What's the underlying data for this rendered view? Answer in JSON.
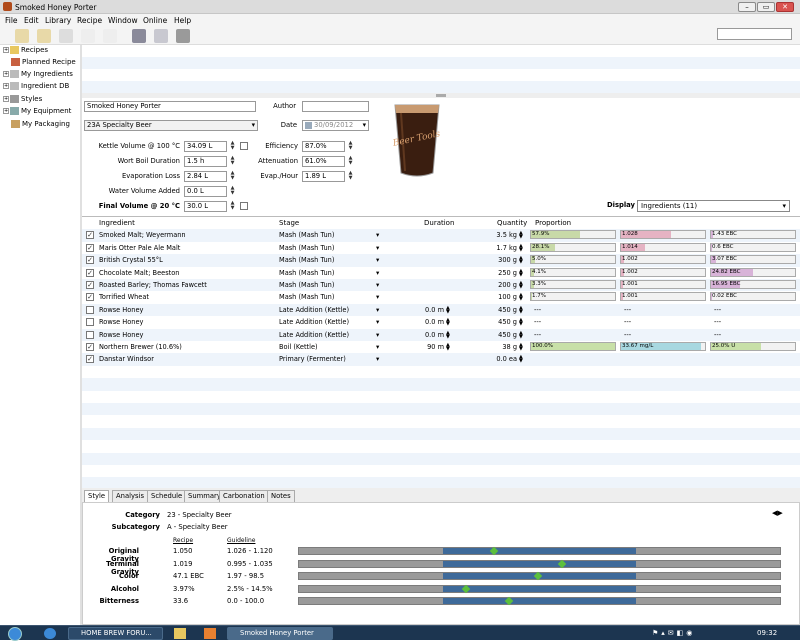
{
  "window": {
    "title": "Smoked Honey Porter"
  },
  "menu": [
    "File",
    "Edit",
    "Library",
    "Recipe",
    "Window",
    "Online",
    "Help"
  ],
  "tree": [
    {
      "label": "Recipes",
      "expander": "+"
    },
    {
      "label": "Planned Recipe",
      "expander": ""
    },
    {
      "label": "My Ingredients",
      "expander": "+"
    },
    {
      "label": "Ingredient DB",
      "expander": "+"
    },
    {
      "label": "Styles",
      "expander": "+"
    },
    {
      "label": "My Equipment",
      "expander": "+"
    },
    {
      "label": "My Packaging",
      "expander": ""
    }
  ],
  "recipe": {
    "name": "Smoked Honey Porter",
    "author_label": "Author",
    "author": "",
    "style": "23A Specialty Beer",
    "date_label": "Date",
    "date": "30/09/2012",
    "params": [
      {
        "label": "Kettle Volume @ 100 °C",
        "value": "34.09 L"
      },
      {
        "label": "Wort Boil Duration",
        "value": "1.5 h"
      },
      {
        "label": "Evaporation Loss",
        "value": "2.84 L"
      },
      {
        "label": "Water Volume Added",
        "value": "0.0 L"
      },
      {
        "label": "Final Volume @ 20 °C",
        "value": "30.0 L"
      }
    ],
    "params2": [
      {
        "label": "Efficiency",
        "value": "87.0%"
      },
      {
        "label": "Attenuation",
        "value": "61.0%"
      },
      {
        "label": "Evap./Hour",
        "value": "1.89 L"
      }
    ],
    "display_label": "Display",
    "display_value": "Ingredients (11)",
    "glass_logo": "Beer Tools"
  },
  "table": {
    "headers": {
      "ingredient": "Ingredient",
      "stage": "Stage",
      "duration": "Duration",
      "quantity": "Quantity",
      "proportion": "Proportion"
    },
    "rows": [
      {
        "checked": true,
        "name": "Smoked Malt; Weyermann",
        "stage": "Mash (Mash Tun)",
        "duration": "",
        "qty": "3.5 kg",
        "p1": "57.9%",
        "p1v": 0.579,
        "p2": "1.028",
        "p2v": 0.6,
        "p3": "1.43 EBC",
        "p3v": 0.02
      },
      {
        "checked": true,
        "name": "Maris Otter Pale Ale Malt",
        "stage": "Mash (Mash Tun)",
        "duration": "",
        "qty": "1.7 kg",
        "p1": "28.1%",
        "p1v": 0.281,
        "p2": "1.014",
        "p2v": 0.28,
        "p3": "0.6 EBC",
        "p3v": 0.01
      },
      {
        "checked": true,
        "name": "British Crystal 55°L",
        "stage": "Mash (Mash Tun)",
        "duration": "",
        "qty": "300 g",
        "p1": "5.0%",
        "p1v": 0.05,
        "p2": "1.002",
        "p2v": 0.04,
        "p3": "3.07 EBC",
        "p3v": 0.06
      },
      {
        "checked": true,
        "name": "Chocolate Malt; Beeston",
        "stage": "Mash (Mash Tun)",
        "duration": "",
        "qty": "250 g",
        "p1": "4.1%",
        "p1v": 0.041,
        "p2": "1.002",
        "p2v": 0.04,
        "p3": "24.82 EBC",
        "p3v": 0.5
      },
      {
        "checked": true,
        "name": "Roasted Barley; Thomas Fawcett",
        "stage": "Mash (Mash Tun)",
        "duration": "",
        "qty": "200 g",
        "p1": "3.3%",
        "p1v": 0.033,
        "p2": "1.001",
        "p2v": 0.02,
        "p3": "16.95 EBC",
        "p3v": 0.34
      },
      {
        "checked": true,
        "name": "Torrified Wheat",
        "stage": "Mash (Mash Tun)",
        "duration": "",
        "qty": "100 g",
        "p1": "1.7%",
        "p1v": 0.017,
        "p2": "1.001",
        "p2v": 0.02,
        "p3": "0.02 EBC",
        "p3v": 0.0
      },
      {
        "checked": false,
        "name": "Rowse Honey",
        "stage": "Late Addition (Kettle)",
        "duration": "0.0 m",
        "qty": "450 g",
        "p1": "---",
        "p1v": null,
        "p2": "---",
        "p2v": null,
        "p3": "---",
        "p3v": null
      },
      {
        "checked": false,
        "name": "Rowse Honey",
        "stage": "Late Addition (Kettle)",
        "duration": "0.0 m",
        "qty": "450 g",
        "p1": "---",
        "p1v": null,
        "p2": "---",
        "p2v": null,
        "p3": "---",
        "p3v": null
      },
      {
        "checked": false,
        "name": "Rowse Honey",
        "stage": "Late Addition (Kettle)",
        "duration": "0.0 m",
        "qty": "450 g",
        "p1": "---",
        "p1v": null,
        "p2": "---",
        "p2v": null,
        "p3": "---",
        "p3v": null
      },
      {
        "checked": true,
        "name": "Northern Brewer (10.6%)",
        "stage": "Boil (Kettle)",
        "duration": "90 m",
        "qty": "38 g",
        "p1": "100.0%",
        "p1v": 1.0,
        "p2": "33.67 mg/L",
        "p2v": 0.95,
        "p3": "25.0% U",
        "p3v": 0.6
      },
      {
        "checked": true,
        "name": "Danstar Windsor",
        "stage": "Primary (Fermenter)",
        "duration": "",
        "qty": "0.0 ea",
        "p1": "",
        "p1v": null,
        "p2": "",
        "p2v": null,
        "p3": "",
        "p3v": null
      }
    ]
  },
  "tabs": [
    "Style",
    "Analysis",
    "Schedule",
    "Summary",
    "Carbonation",
    "Notes"
  ],
  "style_guide": {
    "category_label": "Category",
    "category": "23 - Specialty Beer",
    "subcategory_label": "Subcategory",
    "subcategory": "A - Specialty Beer",
    "recipe_header": "Recipe",
    "guideline_header": "Guideline",
    "rows": [
      {
        "label": "Original Gravity",
        "recipe": "1.050",
        "guideline": "1.026 - 1.120",
        "range": [
          0.3,
          0.7
        ],
        "marker": 0.4
      },
      {
        "label": "Terminal Gravity",
        "recipe": "1.019",
        "guideline": "0.995 - 1.035",
        "range": [
          0.3,
          0.7
        ],
        "marker": 0.54
      },
      {
        "label": "Color",
        "recipe": "47.1 EBC",
        "guideline": "1.97 - 98.5",
        "range": [
          0.3,
          0.7
        ],
        "marker": 0.49
      },
      {
        "label": "Alcohol",
        "recipe": "3.97%",
        "guideline": "2.5% - 14.5%",
        "range": [
          0.3,
          0.7
        ],
        "marker": 0.34
      },
      {
        "label": "Bitterness",
        "recipe": "33.6",
        "guideline": "0.0 - 100.0",
        "range": [
          0.3,
          0.7
        ],
        "marker": 0.43
      }
    ]
  },
  "taskbar": {
    "items": [
      "HOME BREW FORU...",
      "Smoked Honey Porter"
    ],
    "clock": "09:32"
  },
  "colors": {
    "p1": "#c8d9a8",
    "p2": "#e5b3c3",
    "p3": "#d8b3d8",
    "hop1": "#c8e0a8",
    "hop2": "#a8d8e0",
    "hop3": "#c8e0a8",
    "range": "#3e6a9a",
    "marker": "#5cbf3c"
  }
}
